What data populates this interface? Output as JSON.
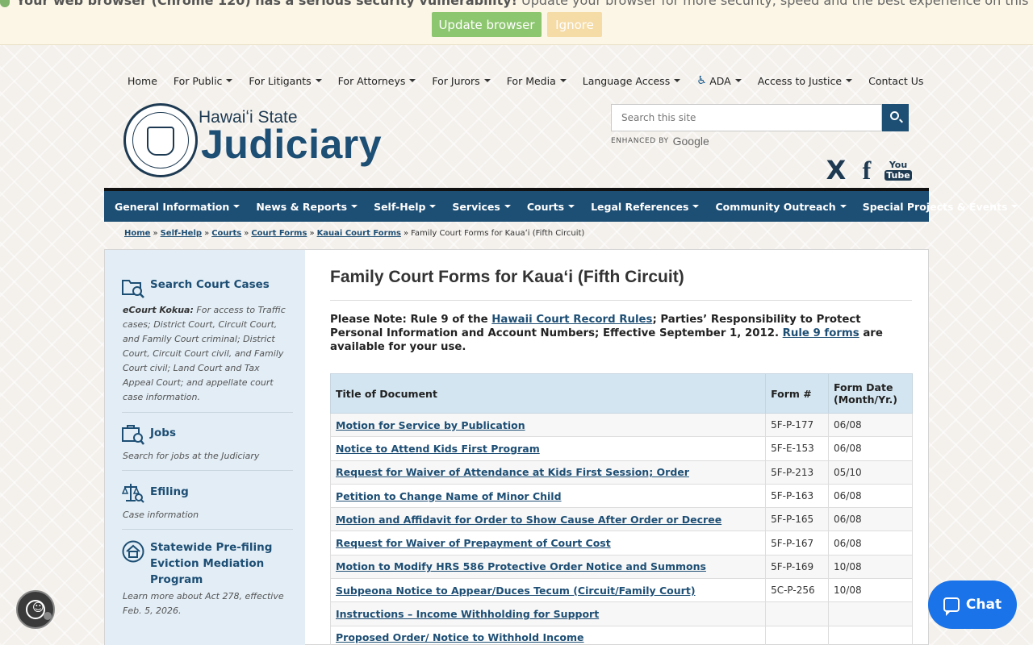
{
  "banner": {
    "text_bold": "Your web browser (Chrome 120) has a serious security vulnerability!",
    "text_rest": " Update your browser for more security, speed and the best experience on this site.",
    "update_label": "Update browser",
    "ignore_label": "Ignore"
  },
  "top_nav": [
    "Home",
    "For Public",
    "For Litigants",
    "For Attorneys",
    "For Jurors",
    "For Media",
    "Language Access",
    "ADA",
    "Access to Justice",
    "Contact Us"
  ],
  "logo": {
    "small": "Hawaiʻi State",
    "big": "Judiciary"
  },
  "search": {
    "placeholder": "Search this site",
    "enhanced": "ENHANCED BY",
    "google": "Google"
  },
  "social": {
    "x": "X",
    "fb": "f",
    "yt_top": "You",
    "yt_bottom": "Tube"
  },
  "main_nav": [
    "General Information",
    "News & Reports",
    "Self-Help",
    "Services",
    "Courts",
    "Legal References",
    "Community Outreach",
    "Special Projects & Events"
  ],
  "breadcrumb": {
    "links": [
      "Home",
      "Self-Help",
      "Courts",
      "Court Forms",
      "Kauai Court Forms"
    ],
    "current": "Family Court Forms for Kauaʻi (Fifth Circuit)",
    "sep": "»"
  },
  "sidebar": {
    "search_cases": {
      "title": "Search Court Cases",
      "desc_bold": "eCourt Kokua:",
      "desc": " For access to Traffic cases; District Court, Circuit Court, and Family Court criminal; District Court, Circuit Court civil, and Family Court civil; Land Court and Tax Appeal Court; and appellate court case information."
    },
    "jobs": {
      "title": "Jobs",
      "desc": "Search for jobs at the Judiciary"
    },
    "efiling": {
      "title": "Efiling",
      "desc": "Case information"
    },
    "eviction": {
      "title": "Statewide Pre-filing Eviction Mediation Program",
      "desc": "Learn more about Act 278, effective Feb. 5, 2026."
    }
  },
  "main": {
    "title": "Family Court Forms for Kauaʻi (Fifth Circuit)",
    "note": {
      "p1": "Please Note: Rule 9 of the ",
      "link1": "Hawaii Court Record Rules",
      "p2": "; Parties’ Responsibility to Protect Personal Information and Account Numbers; Effective September 1, 2012. ",
      "link2": "Rule 9 forms",
      "p3": " are available for your use."
    },
    "table": {
      "headers": [
        "Title of Document",
        "Form #",
        "Form Date (Month/Yr.)"
      ],
      "rows": [
        [
          "Motion for Service by Publication",
          "5F-P-177",
          "06/08"
        ],
        [
          "Notice to Attend Kids First Program",
          "5F-E-153",
          "06/08"
        ],
        [
          "Request for Waiver of Attendance at Kids First Session; Order",
          "5F-P-213",
          "05/10"
        ],
        [
          "Petition to Change Name of Minor Child",
          "5F-P-163",
          "06/08"
        ],
        [
          "Motion and Affidavit for Order to Show Cause After Order or Decree",
          "5F-P-165",
          "06/08"
        ],
        [
          "Request for Waiver of Prepayment of Court Cost",
          "5F-P-167",
          "06/08"
        ],
        [
          "Motion to Modify HRS 586 Protective Order Notice and Summons",
          "5F-P-169",
          "10/08"
        ],
        [
          "Subpeona Notice to Appear/Duces Tecum (Circuit/Family Court)",
          "5C-P-256",
          "10/08"
        ],
        [
          "Instructions – Income Withholding for Support",
          "",
          ""
        ],
        [
          "Proposed Order/ Notice to Withhold Income",
          "",
          ""
        ]
      ]
    }
  },
  "chat": {
    "label": "Chat"
  },
  "colors": {
    "brand": "#1d4e74",
    "sidebar_bg": "#e2edf5",
    "table_header": "#d3e5f0",
    "chat": "#1a73e8"
  }
}
